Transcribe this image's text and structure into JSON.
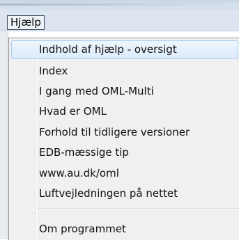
{
  "menubar": {
    "menu_label": "Hjælp"
  },
  "menu": {
    "items": [
      {
        "label": "Indhold af hjælp - oversigt",
        "highlighted": true
      },
      {
        "label": "Index"
      },
      {
        "label": "I gang med OML-Multi"
      },
      {
        "label": "Hvad er OML"
      },
      {
        "label": "Forhold til tidligere versioner"
      },
      {
        "label": "EDB-mæssige tip"
      },
      {
        "label": "www.au.dk/oml"
      },
      {
        "label": "Luftvejledningen på nettet"
      },
      {
        "label": "Om programmet"
      }
    ]
  }
}
